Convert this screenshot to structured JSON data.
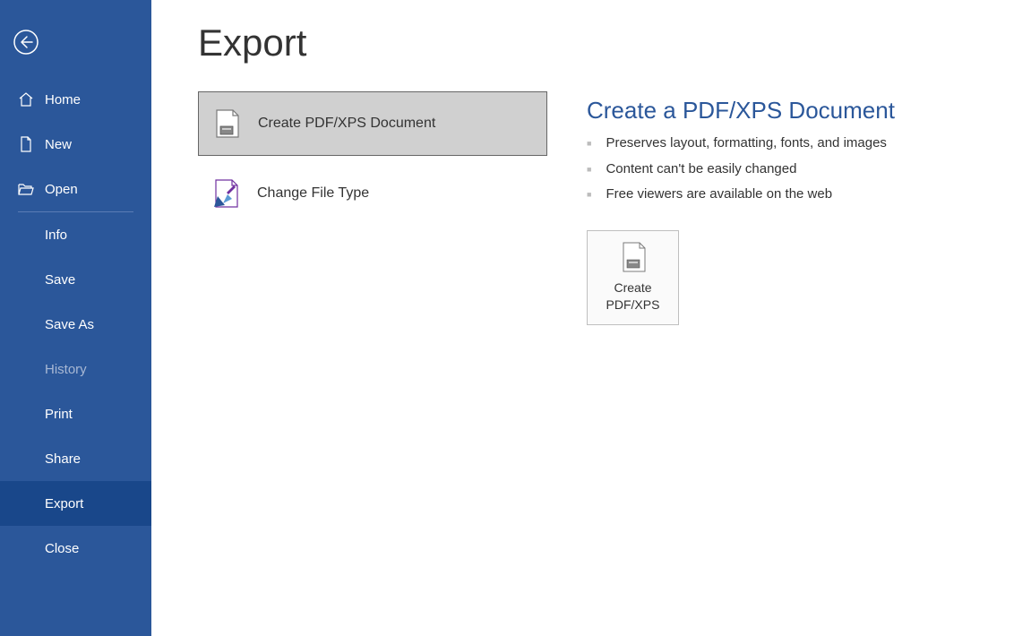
{
  "sidebar": {
    "home": "Home",
    "new": "New",
    "open": "Open",
    "info": "Info",
    "save": "Save",
    "saveas": "Save As",
    "history": "History",
    "print": "Print",
    "share": "Share",
    "export": "Export",
    "close": "Close"
  },
  "page": {
    "title": "Export"
  },
  "options": {
    "pdf": "Create PDF/XPS Document",
    "change": "Change File Type"
  },
  "detail": {
    "title": "Create a PDF/XPS Document",
    "b1": "Preserves layout, formatting, fonts, and images",
    "b2": "Content can't be easily changed",
    "b3": "Free viewers are available on the web",
    "btn1": "Create",
    "btn2": "PDF/XPS"
  }
}
